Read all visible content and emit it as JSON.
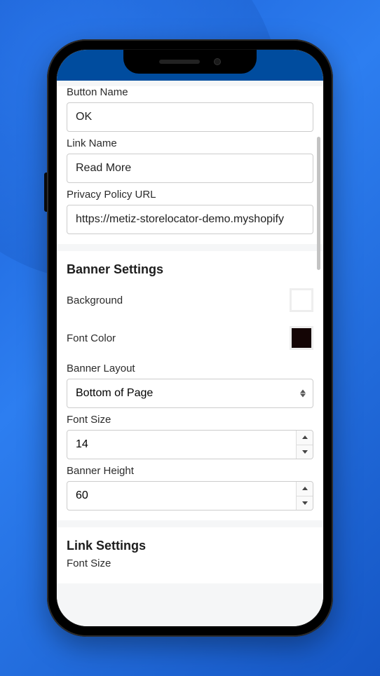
{
  "top_fields": {
    "button_name": {
      "label": "Button Name",
      "value": "OK"
    },
    "link_name": {
      "label": "Link Name",
      "value": "Read More"
    },
    "privacy_url": {
      "label": "Privacy Policy URL",
      "value": "https://metiz-storelocator-demo.myshopify"
    }
  },
  "banner": {
    "title": "Banner Settings",
    "background_label": "Background",
    "background_color": "#ffffff",
    "font_color_label": "Font Color",
    "font_color": "#140505",
    "layout_label": "Banner Layout",
    "layout_value": "Bottom of Page",
    "font_size_label": "Font Size",
    "font_size_value": "14",
    "height_label": "Banner Height",
    "height_value": "60"
  },
  "link": {
    "title": "Link Settings",
    "font_size_label": "Font Size"
  }
}
